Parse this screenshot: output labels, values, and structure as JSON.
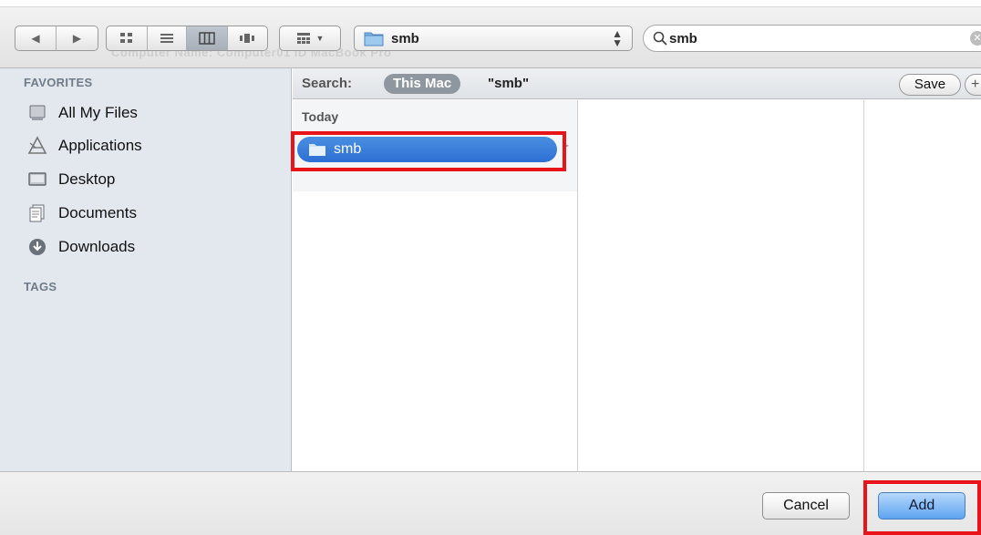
{
  "toolbar": {
    "path_label": "smb",
    "ghost_text": "Computer Name:    Computer01 ID MacBook Pro",
    "search": {
      "value": "smb"
    }
  },
  "sidebar": {
    "favorites_heading": "FAVORITES",
    "items": [
      {
        "label": "All My Files",
        "icon": "all-files-icon"
      },
      {
        "label": "Applications",
        "icon": "applications-icon"
      },
      {
        "label": "Desktop",
        "icon": "desktop-icon"
      },
      {
        "label": "Documents",
        "icon": "documents-icon"
      },
      {
        "label": "Downloads",
        "icon": "downloads-icon"
      }
    ],
    "tags_heading": "TAGS"
  },
  "scope": {
    "label": "Search:",
    "this_mac": "This Mac",
    "query": "\"smb\"",
    "save": "Save",
    "add": "+"
  },
  "results": {
    "group_header": "Today",
    "items": [
      {
        "label": "smb",
        "selected": true
      }
    ]
  },
  "buttons": {
    "cancel": "Cancel",
    "add": "Add"
  },
  "colors": {
    "highlight": "#e8141a",
    "selection": "#2e6fd3",
    "sidebar_bg": "#e3e8ee"
  }
}
